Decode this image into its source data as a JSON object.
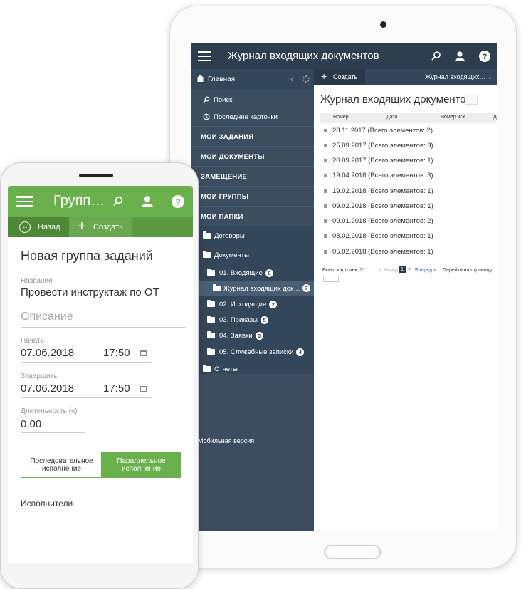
{
  "tablet": {
    "app_title": "Журнал входящих документов",
    "sidebar": {
      "home_label": "Главная",
      "search_label": "Поиск",
      "recent_label": "Последние карточки",
      "sections": [
        "МОИ ЗАДАНИЯ",
        "МОИ ДОКУМЕНТЫ",
        "ЗАМЕЩЕНИЕ",
        "МОИ ГРУППЫ",
        "МОИ ПАПКИ"
      ],
      "tree": {
        "contracts": "Договоры",
        "documents": "Документы",
        "incoming": "01. Входящие",
        "incoming_count": "0",
        "journal": "Журнал входящих док…",
        "journal_count": "7",
        "outgoing": "02. Исходящие",
        "outgoing_count": "2",
        "orders": "03. Приказы",
        "orders_count": "5",
        "requests": "04. Заявки",
        "requests_count": "0",
        "memos": "05. Служебные записки",
        "memos_count": "4",
        "reports": "Отчеты"
      },
      "mobile_version": "Мобильная версия"
    },
    "toolbar": {
      "create_label": "Создать",
      "journal_select": "Журнал входящих…"
    },
    "content": {
      "title": "Журнал входящих документов",
      "columns": [
        "Номер",
        "Дата",
        "Номер исх",
        "Д"
      ],
      "rows": [
        "28.11.2017 (Всего элементов: 2)",
        "25.09.2017 (Всего элементов: 3)",
        "20.09.2017 (Всего элементов: 1)",
        "19.04.2018 (Всего элементов: 3)",
        "19.02.2018 (Всего элементов: 1)",
        "09.02.2018 (Всего элементов: 1)",
        "09.01.2018 (Всего элементов: 2)",
        "08.02.2018 (Всего элементов: 1)",
        "05.02.2018 (Всего элементов: 1)"
      ],
      "pager": {
        "total": "Всего карточек: 21",
        "prev": "« Назад",
        "page1": "1",
        "page2": "2",
        "next": "Вперед »",
        "goto": "Перейти на страницу"
      }
    }
  },
  "phone": {
    "app_title": "Групп…",
    "back_label": "Назад",
    "create_label": "Создать",
    "form_title": "Новая группа заданий",
    "name_label": "Название",
    "name_value": "Провести инструктаж по ОТ",
    "description_placeholder": "Описание",
    "start_label": "Начать",
    "start_date": "07.06.2018",
    "start_time": "17:50",
    "end_label": "Завершить",
    "end_date": "07.06.2018",
    "end_time": "17:50",
    "duration_label": "Длительность (ч)",
    "duration_value": "0,00",
    "sequential_label": "Последовательное исполнение",
    "parallel_label": "Параллельное исполнение",
    "executors_label": "Исполнители"
  },
  "colors": {
    "tablet_dark": "#2f3e4f",
    "phone_green": "#6ab04c"
  },
  "icons": [
    "menu-icon",
    "search-icon",
    "user-icon",
    "help-icon",
    "home-icon",
    "history-icon",
    "folder-icon",
    "calendar-icon",
    "back-icon",
    "plus-icon"
  ]
}
